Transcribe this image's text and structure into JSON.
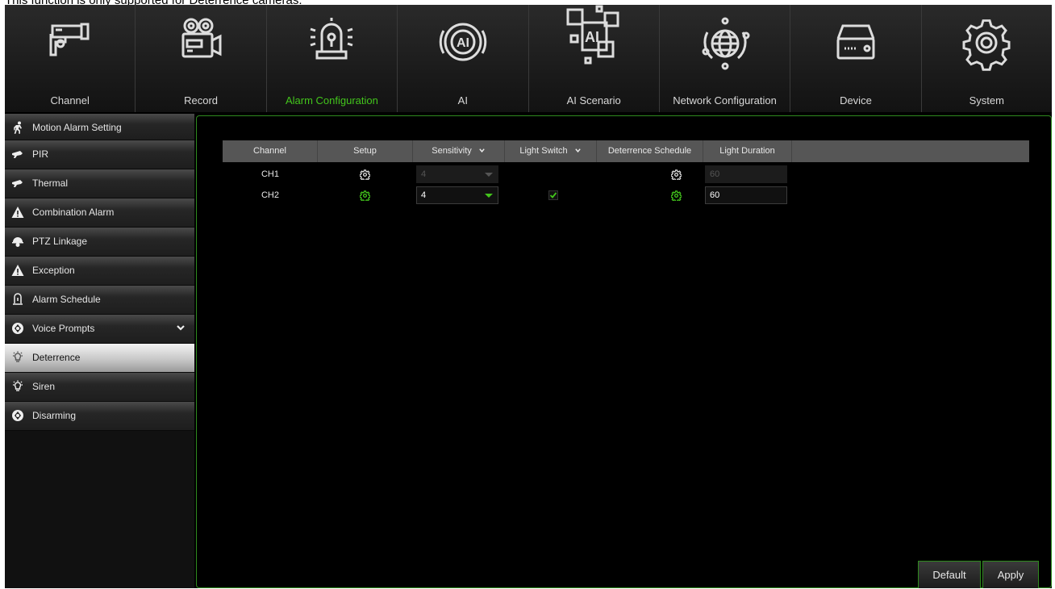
{
  "notice": "This function is only supported for Deterrence cameras.",
  "nav": {
    "items": [
      {
        "label": "Channel",
        "icon": "camera-icon"
      },
      {
        "label": "Record",
        "icon": "video-camera-icon"
      },
      {
        "label": "Alarm Configuration",
        "icon": "alarm-light-icon",
        "active": true
      },
      {
        "label": "AI",
        "icon": "ai-icon"
      },
      {
        "label": "AI Scenario",
        "icon": "ai-scenario-icon"
      },
      {
        "label": "Network Configuration",
        "icon": "globe-icon"
      },
      {
        "label": "Device",
        "icon": "hard-drive-icon"
      },
      {
        "label": "System",
        "icon": "gear-icon"
      }
    ]
  },
  "sidebar": {
    "items": [
      {
        "label": "Motion Alarm Setting",
        "icon": "running-person-icon"
      },
      {
        "label": "PIR",
        "icon": "pir-sensor-icon"
      },
      {
        "label": "Thermal",
        "icon": "thermal-icon"
      },
      {
        "label": "Combination Alarm",
        "icon": "warning-icon"
      },
      {
        "label": "PTZ Linkage",
        "icon": "ptz-camera-icon"
      },
      {
        "label": "Exception",
        "icon": "warning-icon"
      },
      {
        "label": "Alarm Schedule",
        "icon": "schedule-icon"
      },
      {
        "label": "Voice Prompts",
        "icon": "voice-icon"
      },
      {
        "label": "Deterrence",
        "icon": "light-bulb-icon",
        "active": true
      },
      {
        "label": "Siren",
        "icon": "siren-icon"
      },
      {
        "label": "Disarming",
        "icon": "disarm-icon"
      }
    ]
  },
  "table": {
    "headers": {
      "channel": "Channel",
      "setup": "Setup",
      "sensitivity": "Sensitivity",
      "light_switch": "Light Switch",
      "deterrence_schedule": "Deterrence Schedule",
      "light_duration": "Light Duration"
    },
    "rows": [
      {
        "channel": "CH1",
        "sensitivity": "4",
        "light_switch": false,
        "light_duration": "60",
        "enabled": false
      },
      {
        "channel": "CH2",
        "sensitivity": "4",
        "light_switch": true,
        "light_duration": "60",
        "enabled": true
      }
    ]
  },
  "buttons": {
    "default": "Default",
    "apply": "Apply"
  },
  "colors": {
    "accent": "#43c51c",
    "background": "#000000",
    "header": "#565656"
  }
}
